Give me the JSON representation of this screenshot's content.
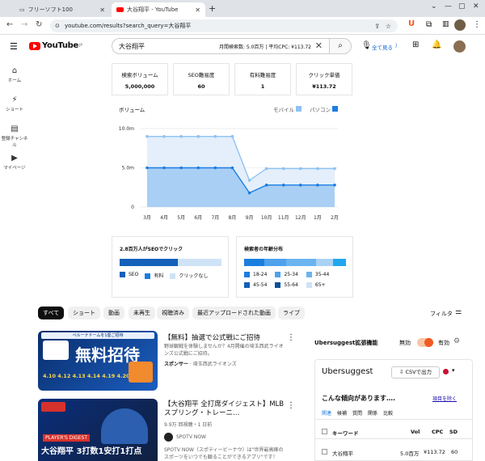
{
  "browser": {
    "tab_inactive": "フリーソフト100",
    "tab_active": "大谷翔平 - YouTube",
    "url": "youtube.com/results?search_query=大谷翔平"
  },
  "youtube": {
    "logo": "YouTube",
    "logo_sup": "JP",
    "search_query": "大谷翔平",
    "search_meta": "月間検索数: 5.0百万 | 平均CPC: ¥113.72",
    "zenbu": "全て見る",
    "sidebar": [
      {
        "icon": "home-icon",
        "label": "ホーム",
        "glyph": "⌂"
      },
      {
        "icon": "shorts-icon",
        "label": "ショート",
        "glyph": "⚡"
      },
      {
        "icon": "subscriptions-icon",
        "label": "登録チャンネル",
        "glyph": "▤"
      },
      {
        "icon": "library-icon",
        "label": "マイページ",
        "glyph": "▶"
      }
    ]
  },
  "stats": [
    {
      "label": "検索ボリューム",
      "value": "5,000,000"
    },
    {
      "label": "SEO難易度",
      "value": "60"
    },
    {
      "label": "有料難易度",
      "value": "1"
    },
    {
      "label": "クリック単価",
      "value": "¥113.72"
    }
  ],
  "chart_data": {
    "type": "area",
    "title": "ボリューム",
    "legend": [
      "モバイル",
      "パソコン"
    ],
    "categories": [
      "3月",
      "4月",
      "5月",
      "6月",
      "7月",
      "8月",
      "9月",
      "10月",
      "11月",
      "12月",
      "1月",
      "2月"
    ],
    "yticks": [
      "10.0m",
      "5.0m",
      "0"
    ],
    "ylim": [
      0,
      10000000
    ],
    "series": [
      {
        "name": "モバイル",
        "values": [
          9000000,
          9000000,
          9000000,
          9000000,
          9000000,
          9000000,
          3400000,
          4900000,
          4900000,
          4900000,
          4900000,
          4900000
        ]
      },
      {
        "name": "パソコン",
        "values": [
          5000000,
          5000000,
          5000000,
          5000000,
          5000000,
          5000000,
          1800000,
          2800000,
          2800000,
          2800000,
          2800000,
          2800000
        ]
      }
    ],
    "colors": {
      "mobile": "#90c2f2",
      "pc": "#1a7ee0"
    }
  },
  "seo_panel": {
    "title": "2.8百万人がSEOでクリック",
    "legend": [
      "SEO",
      "有料",
      "クリックなし"
    ]
  },
  "age_panel": {
    "title": "検索者の年齢分布",
    "legend": [
      "18-24",
      "25-34",
      "35-44",
      "45-54",
      "55-64",
      "65+"
    ]
  },
  "chips": [
    "すべて",
    "ショート",
    "動画",
    "未再生",
    "視聴済み",
    "最近アップロードされた動画",
    "ライブ"
  ],
  "filter": "フィルタ",
  "videos": [
    {
      "title": "【無料】抽選で公式戦にご招待",
      "desc": "野球観戦を体験しませんか？4月開催の埼玉西武ライオンズ公式戦にご招待。",
      "sponsor_label": "スポンサー",
      "channel": "埼玉西武ライオンズ",
      "thumb_text": "無料招待",
      "thumb_dates": "4.10 4.12 4.13 4.14 4.19 4.20"
    },
    {
      "title": "【大谷翔平 全打席ダイジェスト】MLBスプリング・トレーニ…",
      "meta": "9.9万 回視聴・1 日前",
      "channel": "SPOTV NOW",
      "desc": "SPOTV NOW（スポティービーナウ）は\"世界最高峰のスポーツをいつでも観ることができるアプリ\"です！",
      "thumb_text": "大谷翔平 3打数1安打1打点",
      "thumb_top": "PLAYER'S DIGEST"
    }
  ],
  "ubersuggest": {
    "ext_title": "Ubersuggest拡張機能",
    "off": "無効",
    "on": "有効",
    "logo": "Ubersuggest",
    "csv": "CSVで出力",
    "trend": "こんな傾向があります….",
    "trend_link": "項目を除く",
    "tabs": [
      "関連",
      "候補",
      "質問",
      "関係",
      "比較"
    ],
    "cols": [
      "キーワード",
      "Vol",
      "CPC",
      "SD"
    ],
    "row": {
      "kw": "大谷翔平",
      "vol": "5.0百万",
      "cpc": "¥113.72",
      "sd": "60"
    }
  }
}
